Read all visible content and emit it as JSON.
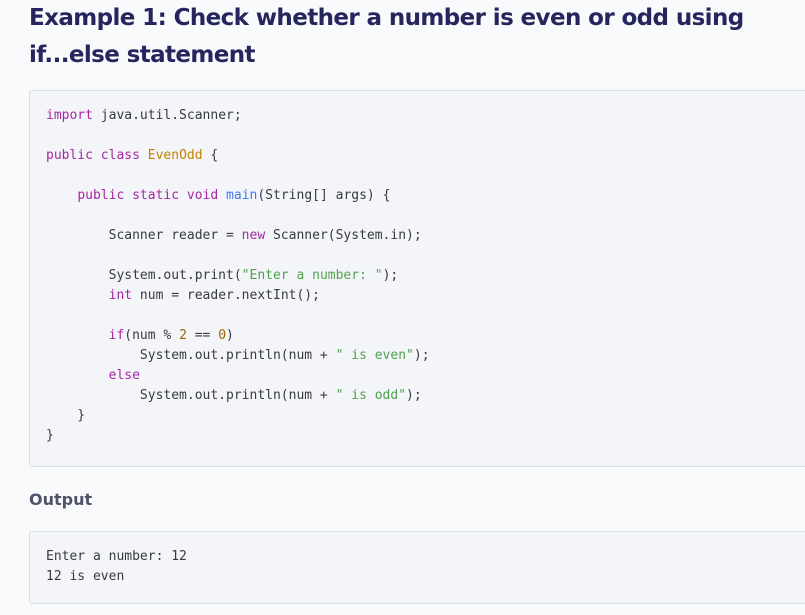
{
  "heading": "Example 1: Check whether a number is even or odd using if...else statement",
  "code_lines": [
    [
      [
        "keyword",
        "import"
      ],
      [
        "plain",
        " java.util.Scanner;"
      ]
    ],
    [],
    [
      [
        "keyword",
        "public"
      ],
      [
        "plain",
        " "
      ],
      [
        "keyword",
        "class"
      ],
      [
        "plain",
        " "
      ],
      [
        "class",
        "EvenOdd"
      ],
      [
        "plain",
        " {"
      ]
    ],
    [],
    [
      [
        "plain",
        "    "
      ],
      [
        "keyword",
        "public"
      ],
      [
        "plain",
        " "
      ],
      [
        "keyword",
        "static"
      ],
      [
        "plain",
        " "
      ],
      [
        "keyword",
        "void"
      ],
      [
        "plain",
        " "
      ],
      [
        "func",
        "main"
      ],
      [
        "plain",
        "(String[] args) {"
      ]
    ],
    [],
    [
      [
        "plain",
        "        Scanner reader = "
      ],
      [
        "keyword",
        "new"
      ],
      [
        "plain",
        " Scanner(System.in);"
      ]
    ],
    [],
    [
      [
        "plain",
        "        System.out.print("
      ],
      [
        "string",
        "\"Enter a number: \""
      ],
      [
        "plain",
        ");"
      ]
    ],
    [
      [
        "plain",
        "        "
      ],
      [
        "keyword",
        "int"
      ],
      [
        "plain",
        " num = reader.nextInt();"
      ]
    ],
    [],
    [
      [
        "plain",
        "        "
      ],
      [
        "keyword",
        "if"
      ],
      [
        "plain",
        "(num % "
      ],
      [
        "number",
        "2"
      ],
      [
        "plain",
        " == "
      ],
      [
        "number",
        "0"
      ],
      [
        "plain",
        ")"
      ]
    ],
    [
      [
        "plain",
        "            System.out.println(num + "
      ],
      [
        "string",
        "\" is even\""
      ],
      [
        "plain",
        ");"
      ]
    ],
    [
      [
        "plain",
        "        "
      ],
      [
        "keyword",
        "else"
      ]
    ],
    [
      [
        "plain",
        "            System.out.println(num + "
      ],
      [
        "string",
        "\" is odd\""
      ],
      [
        "plain",
        ");"
      ]
    ],
    [
      [
        "plain",
        "    }"
      ]
    ],
    [
      [
        "plain",
        "}"
      ]
    ]
  ],
  "output_title": "Output",
  "output_lines": [
    "Enter a number: 12",
    "12 is even"
  ],
  "colors": {
    "heading": "#25265e",
    "keyword": "#a626a4",
    "class_name": "#c18401",
    "function": "#4078f2",
    "string": "#50a14f",
    "number": "#986801",
    "code_background": "#f3f5f9",
    "page_background": "#f9fafc"
  }
}
